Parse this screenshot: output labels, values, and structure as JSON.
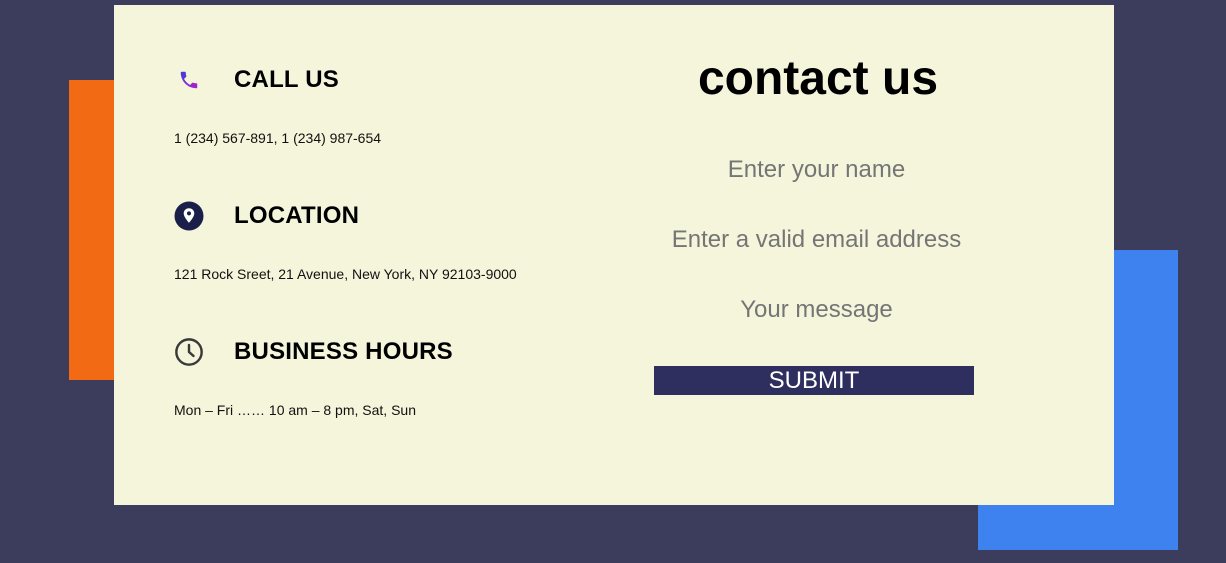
{
  "contact_info": {
    "call": {
      "title": "CALL US",
      "text": "1 (234) 567-891, 1 (234) 987-654",
      "icon": "phone-icon"
    },
    "location": {
      "title": "LOCATION",
      "text": "121 Rock Sreet, 21 Avenue, New York, NY 92103-9000",
      "icon": "map-pin-icon"
    },
    "hours": {
      "title": "BUSINESS HOURS",
      "text": "Mon – Fri …… 10 am – 8 pm, Sat, Sun",
      "icon": "clock-icon"
    }
  },
  "form": {
    "title": "contact us",
    "name_placeholder": "Enter your name",
    "email_placeholder": "Enter a valid email address",
    "message_placeholder": "Your message",
    "submit_label": "SUBMIT"
  },
  "colors": {
    "page_background": "#3c3d5c",
    "card_background": "#f5f5dc",
    "orange_accent": "#f26a14",
    "blue_accent": "#3e82f0",
    "submit_button": "#2e2f5e"
  }
}
